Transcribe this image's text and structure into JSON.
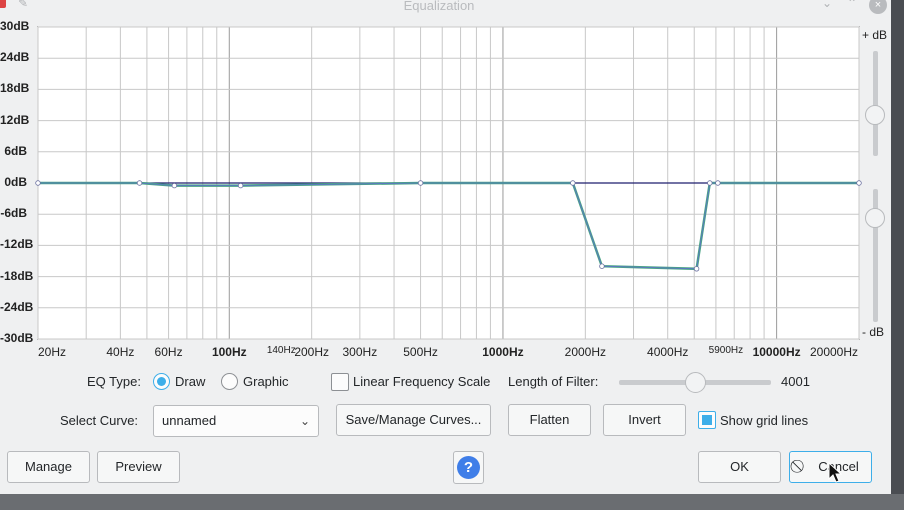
{
  "window": {
    "title": "Equalization",
    "min_icon": "⌄",
    "max_icon": "⌃",
    "close_icon": "×"
  },
  "scale": {
    "plus_db": "+ dB",
    "minus_db": "- dB",
    "db_labels": [
      "30dB",
      "24dB",
      "18dB",
      "12dB",
      "6dB",
      "0dB",
      "-6dB",
      "-12dB",
      "-18dB",
      "-24dB",
      "-30dB"
    ]
  },
  "x_labels": [
    "20Hz",
    "40Hz",
    "60Hz",
    "100Hz",
    "140Hz",
    "200Hz",
    "300Hz",
    "500Hz",
    "1000Hz",
    "2000Hz",
    "4000Hz",
    "5900Hz",
    "10000Hz",
    "20000Hz"
  ],
  "chart_data": {
    "type": "line",
    "x_scale": "log",
    "xlim": [
      20,
      20000
    ],
    "ylim": [
      -30,
      30
    ],
    "grid": true,
    "series": [
      {
        "x": [
          20,
          47,
          63,
          110,
          500,
          1800,
          2300,
          5100,
          5700,
          6100,
          20000
        ],
        "y": [
          0,
          0,
          -0.5,
          -0.5,
          0,
          0,
          -16,
          -16.5,
          0,
          0,
          0
        ]
      }
    ]
  },
  "controls": {
    "eq_type_label": "EQ Type:",
    "draw_label": "Draw",
    "graphic_label": "Graphic",
    "linear_freq_label": "Linear Frequency Scale",
    "filter_length_label": "Length of Filter:",
    "filter_length_value": "4001",
    "filter_fraction": 0.5,
    "select_curve_label": "Select Curve:",
    "curve_value": "unnamed",
    "save_manage_label": "Save/Manage Curves...",
    "flatten_label": "Flatten",
    "invert_label": "Invert",
    "show_grid_label": "Show grid lines",
    "manage_label": "Manage",
    "preview_label": "Preview",
    "help_label": "?",
    "ok_label": "OK",
    "cancel_label": "Cancel"
  }
}
